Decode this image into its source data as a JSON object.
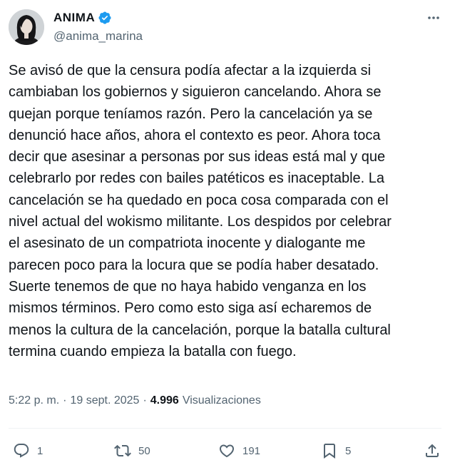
{
  "user": {
    "display_name": "ANIMA",
    "handle": "@anima_marina",
    "verified": true
  },
  "tweet": {
    "text": "Se avisó de que la censura podía afectar a la izquierda si\ncambiaban los gobiernos y siguieron cancelando. Ahora se\nquejan porque teníamos razón. Pero la cancelación ya se\ndenunció hace años, ahora el contexto es peor. Ahora toca\ndecir que asesinar a personas por sus ideas está mal y que\ncelebrarlo por redes con bailes patéticos es inaceptable. La\ncancelación se ha quedado en poca cosa comparada con el\nnivel actual del wokismo militante. Los despidos por celebrar\nel asesinato de un compatriota inocente y dialogante me\nparecen poco para la locura que se podía haber desatado.\nSuerte tenemos de que no haya habido venganza en los\nmismos términos. Pero como esto siga así echaremos de\nmenos la cultura de la cancelación, porque la batalla cultural\ntermina cuando empieza la batalla con fuego.",
    "time": "5:22 p. m.",
    "date": "19 sept. 2025",
    "separator": "·",
    "views": "4.996",
    "views_label": "Visualizaciones"
  },
  "actions": {
    "replies": "1",
    "reposts": "50",
    "likes": "191",
    "bookmarks": "5"
  },
  "icons": {
    "avatar": "avatar",
    "verified": "verified-badge-icon",
    "more": "more-horizontal-icon",
    "reply": "reply-icon",
    "repost": "repost-icon",
    "like": "heart-icon",
    "bookmark": "bookmark-icon",
    "share": "share-icon"
  },
  "colors": {
    "text": "#0f1419",
    "secondary": "#536471",
    "verified": "#1d9bf0",
    "divider": "#eff3f4"
  }
}
